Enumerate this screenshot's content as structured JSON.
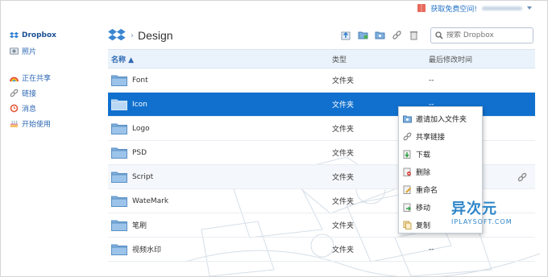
{
  "topbar": {
    "promo": "获取免费空间!",
    "user": ""
  },
  "sidebar": {
    "items": [
      {
        "label": "Dropbox",
        "icon": "dropbox-icon"
      },
      {
        "label": "照片",
        "icon": "photo-icon"
      },
      {
        "label": "正在共享",
        "icon": "rainbow-icon"
      },
      {
        "label": "链接",
        "icon": "link-icon"
      },
      {
        "label": "消息",
        "icon": "clock-icon"
      },
      {
        "label": "开始使用",
        "icon": "cake-icon"
      }
    ]
  },
  "header": {
    "title": "Design",
    "search_placeholder": "搜索 Dropbox"
  },
  "table": {
    "col_name": "名称 ▲",
    "col_type": "类型",
    "col_date": "最后修改时间",
    "rows": [
      {
        "name": "Font",
        "type": "文件夹",
        "date": "--"
      },
      {
        "name": "Icon",
        "type": "文件夹",
        "date": "--"
      },
      {
        "name": "Logo",
        "type": "文件夹",
        "date": "--"
      },
      {
        "name": "PSD",
        "type": "文件夹",
        "date": "--"
      },
      {
        "name": "Script",
        "type": "文件夹",
        "date": "--"
      },
      {
        "name": "WateMark",
        "type": "文件夹",
        "date": "--"
      },
      {
        "name": "笔刷",
        "type": "文件夹",
        "date": "--"
      },
      {
        "name": "视频水印",
        "type": "文件夹",
        "date": "--"
      }
    ]
  },
  "context_menu": {
    "items": [
      {
        "label": "邀请加入文件夹",
        "icon": "invite-folder-icon"
      },
      {
        "label": "共享链接",
        "icon": "share-link-icon"
      },
      {
        "label": "下载",
        "icon": "download-icon"
      },
      {
        "label": "删除",
        "icon": "delete-icon"
      },
      {
        "label": "重命名",
        "icon": "rename-icon"
      },
      {
        "label": "移动",
        "icon": "move-icon"
      },
      {
        "label": "复制",
        "icon": "copy-icon"
      }
    ]
  },
  "watermark": {
    "cn": "异次元",
    "en": "IPLAYSOFT.COM"
  },
  "colors": {
    "accent": "#1170ce",
    "link": "#2d68b3",
    "header_bg": "#eaf2fb"
  }
}
